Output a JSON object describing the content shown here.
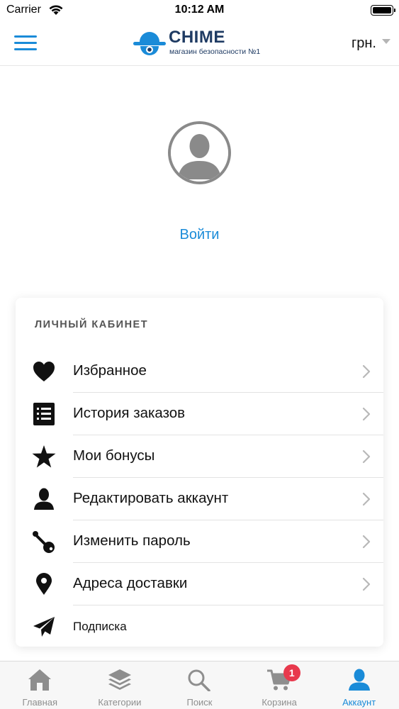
{
  "status_bar": {
    "carrier": "Carrier",
    "time": "10:12 AM"
  },
  "header": {
    "logo_title": "CHIME",
    "logo_subtitle": "магазин безопасности №1",
    "currency": "грн.",
    "menu_icon": "hamburger-menu-icon"
  },
  "profile": {
    "login_label": "Войти",
    "avatar_icon": "user-silhouette-icon"
  },
  "account_section": {
    "title": "ЛИЧНЫЙ КАБИНЕТ",
    "items": [
      {
        "label": "Избранное",
        "icon": "heart-icon"
      },
      {
        "label": "История заказов",
        "icon": "list-icon"
      },
      {
        "label": "Мои бонусы",
        "icon": "star-icon"
      },
      {
        "label": "Редактировать аккаунт",
        "icon": "user-icon"
      },
      {
        "label": "Изменить пароль",
        "icon": "key-icon"
      },
      {
        "label": "Адреса доставки",
        "icon": "map-pin-icon"
      },
      {
        "label": "Подписка",
        "icon": "paper-plane-icon"
      }
    ]
  },
  "tabbar": {
    "tabs": [
      {
        "label": "Главная",
        "icon": "home-icon"
      },
      {
        "label": "Категории",
        "icon": "layers-icon"
      },
      {
        "label": "Поиск",
        "icon": "search-icon"
      },
      {
        "label": "Корзина",
        "icon": "cart-icon",
        "badge": "1"
      },
      {
        "label": "Аккаунт",
        "icon": "account-icon",
        "active": true
      }
    ]
  },
  "colors": {
    "accent": "#1a8bd8",
    "badge": "#e8394d",
    "logo_dark": "#1f3b63",
    "inactive_tab": "#8e8e8e"
  }
}
